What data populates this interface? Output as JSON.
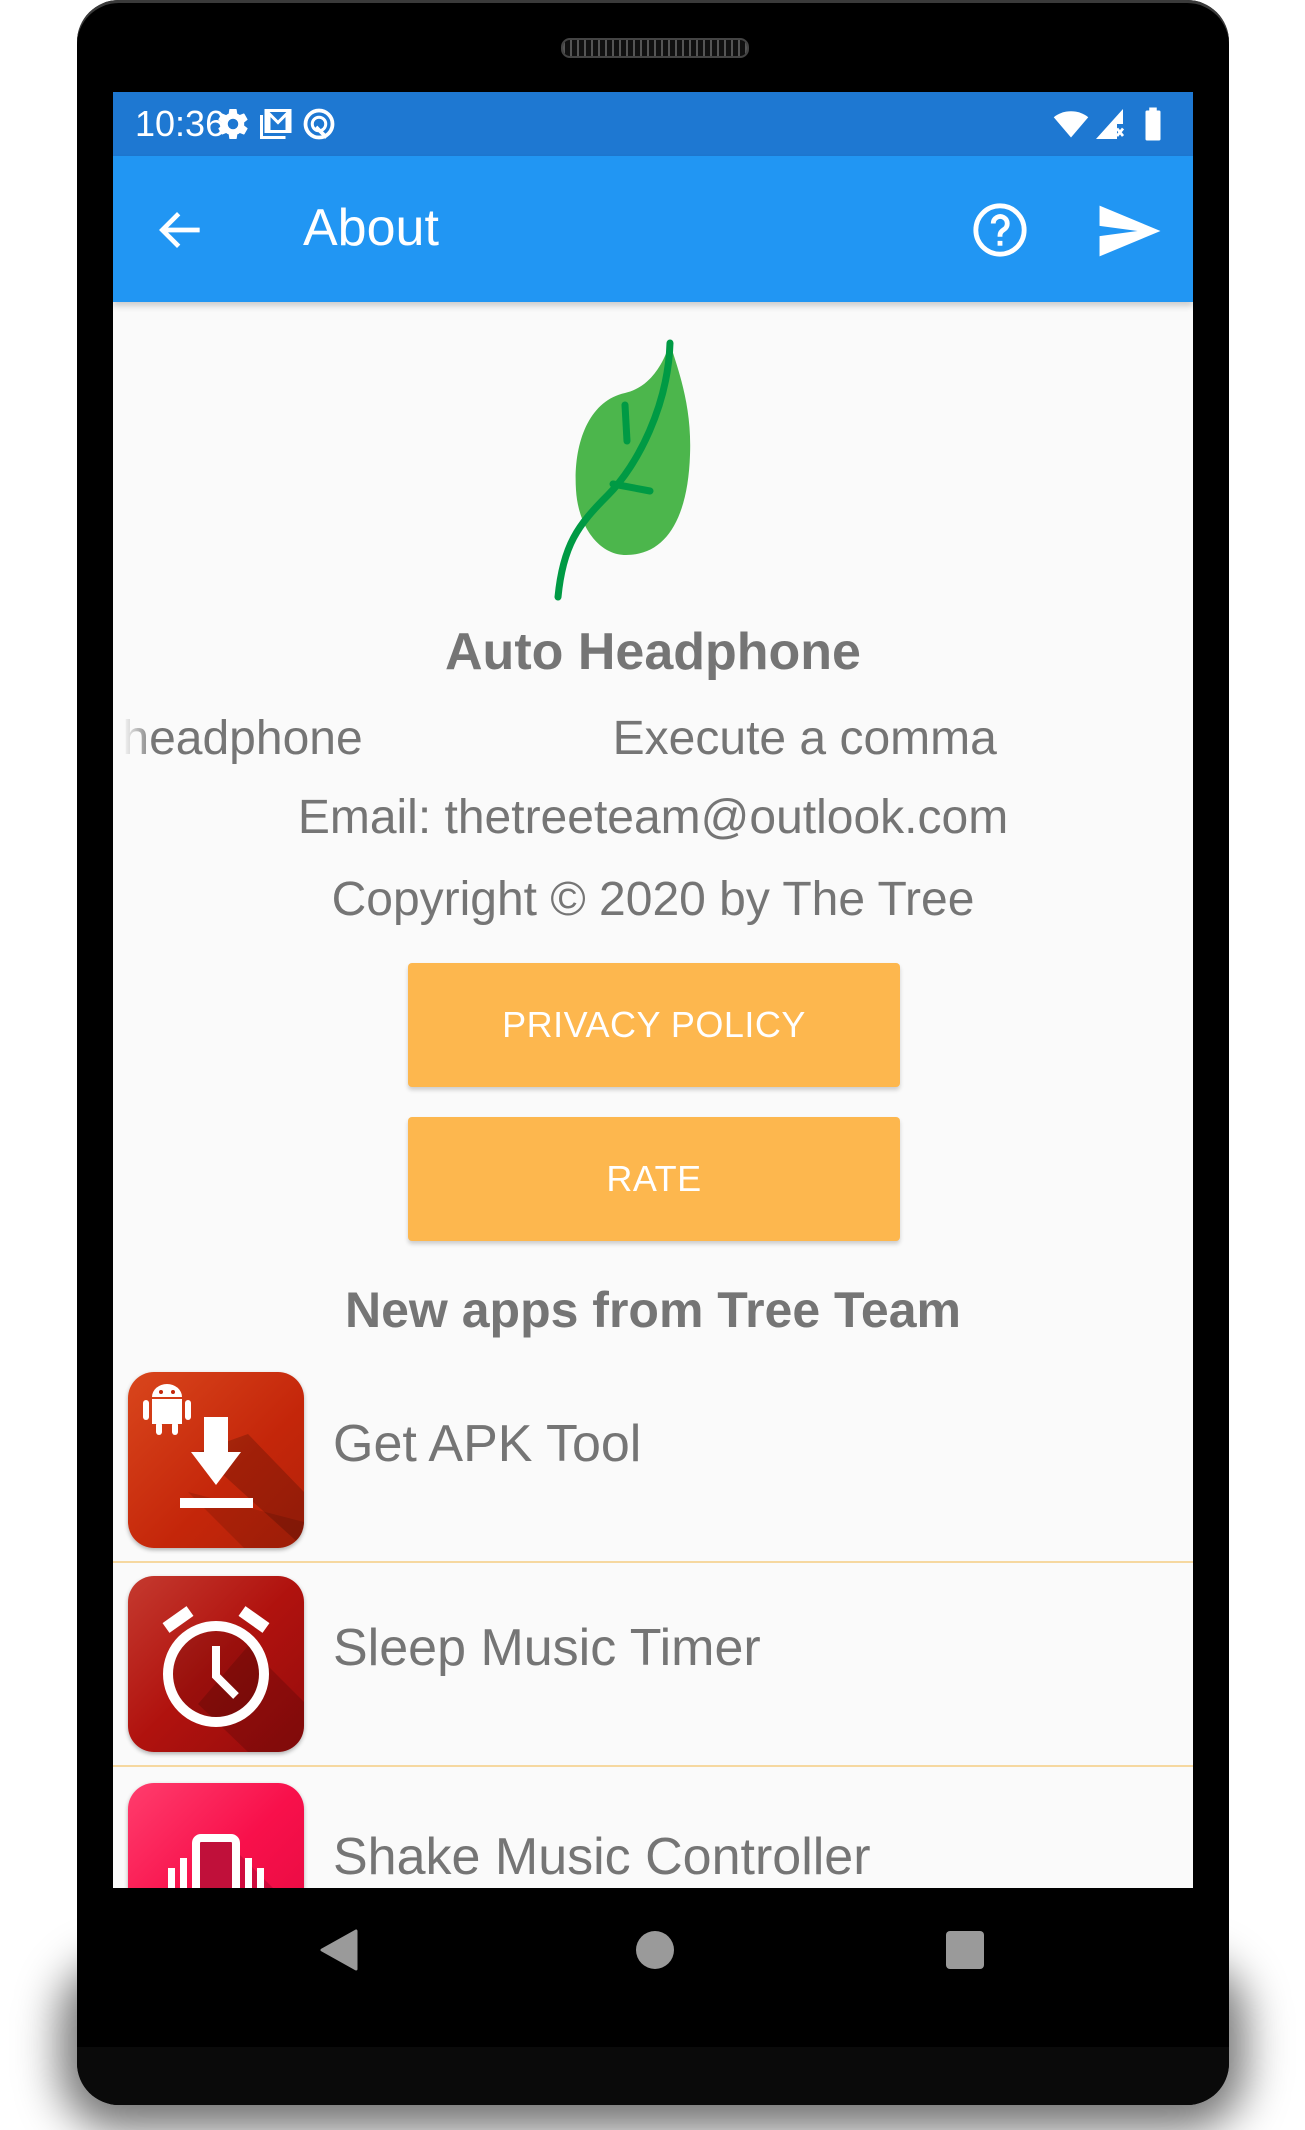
{
  "status_bar": {
    "time": "10:36",
    "left_icons": [
      "settings-gear-icon",
      "gmail-icon",
      "app-notification-icon"
    ],
    "right_icons": [
      "wifi-icon",
      "cell-signal-no-data-icon",
      "battery-icon"
    ]
  },
  "app_bar": {
    "title": "About",
    "back_icon": "arrow-back-icon",
    "actions": [
      "help-icon",
      "send-icon"
    ]
  },
  "about": {
    "logo": "leaf-icon",
    "app_name": "Auto Headphone",
    "marquee": [
      "lug headphone",
      "Execute a comma"
    ],
    "email": "Email: thetreeteam@outlook.com",
    "copyright": "Copyright © 2020 by The Tree"
  },
  "buttons": {
    "privacy_policy": "PRIVACY POLICY",
    "rate": "RATE"
  },
  "colors": {
    "status_bar": "#1e78d2",
    "app_bar": "#2196f3",
    "button": "#fdb74e",
    "text": "#757575",
    "leaf": "#4cb64c",
    "leaf_vein": "#009a44",
    "divider": "#f6d8a0"
  },
  "new_apps": {
    "title": "New apps from Tree Team",
    "items": [
      {
        "name": "Get APK Tool",
        "icon": "apk-download-icon"
      },
      {
        "name": "Sleep Music Timer",
        "icon": "alarm-clock-icon"
      },
      {
        "name": "Shake Music Controller",
        "icon": "phone-vibrate-icon"
      }
    ]
  },
  "nav_bar": {
    "buttons": [
      "back-nav-icon",
      "home-nav-icon",
      "recents-nav-icon"
    ]
  }
}
